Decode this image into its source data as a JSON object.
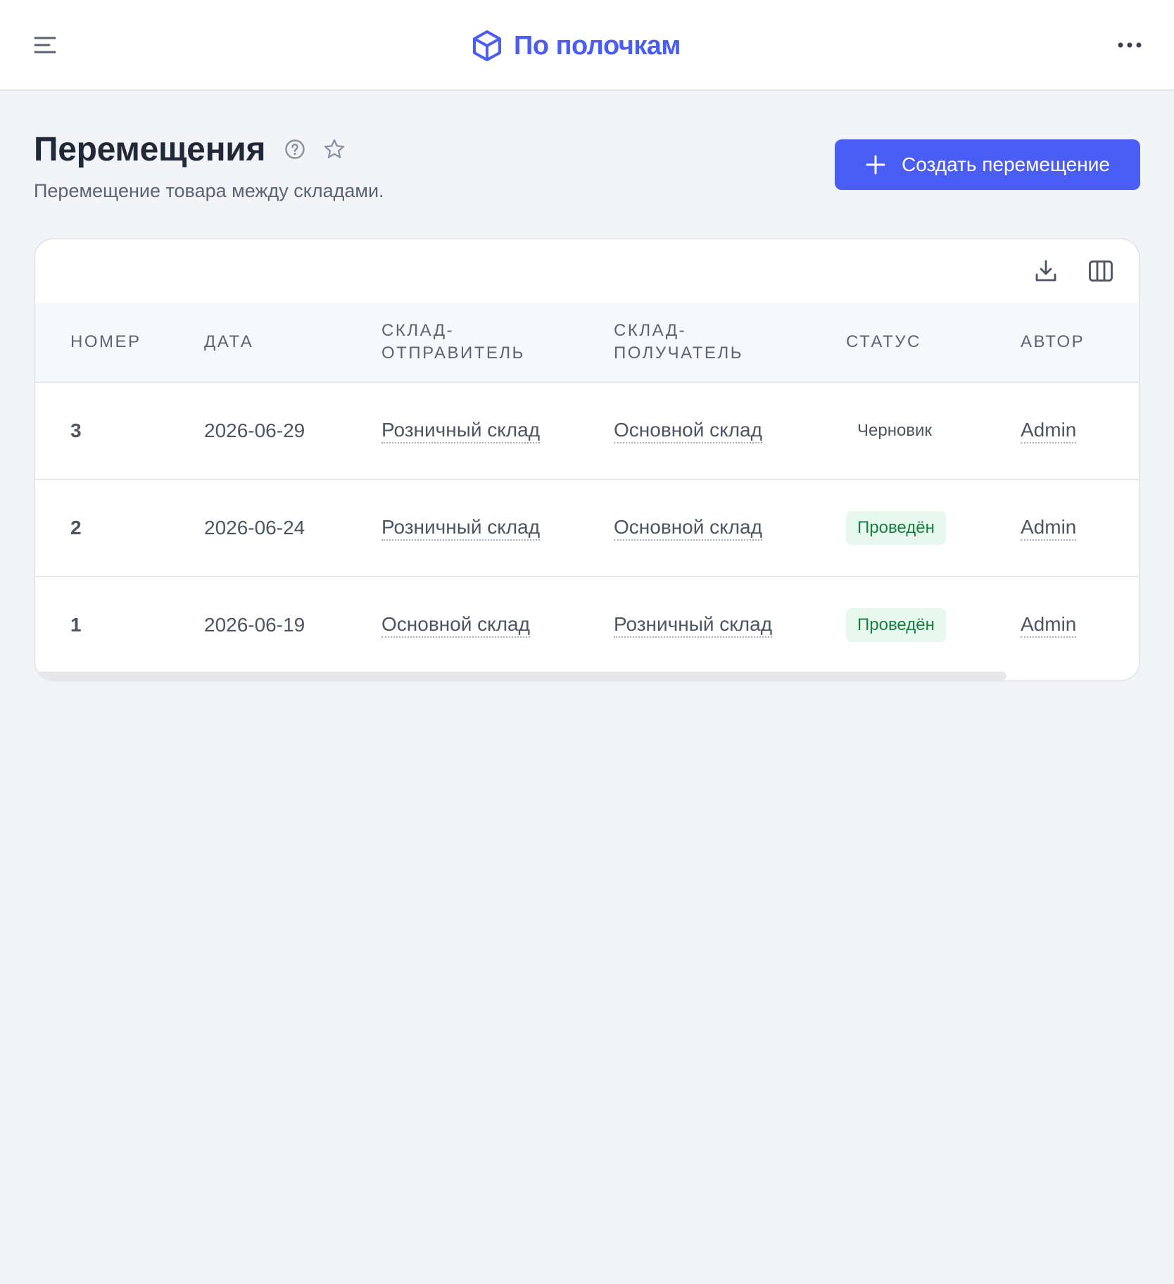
{
  "app": {
    "name": "По полочкам",
    "brand_color": "#4a5df5"
  },
  "header": {
    "menu_icon": "hamburger-menu-icon",
    "logo_icon": "cube-icon",
    "more_icon": "more-dots-icon"
  },
  "page": {
    "title": "Перемещения",
    "subtitle": "Перемещение товара между складами.",
    "help_icon": "help-circle-icon",
    "favorite_icon": "star-outline-icon",
    "create_button_label": "Создать перемещение",
    "create_button_icon": "plus-icon"
  },
  "table": {
    "toolbar": {
      "download_icon": "download-icon",
      "columns_icon": "columns-icon"
    },
    "columns": [
      "НОМЕР",
      "ДАТА",
      "СКЛАД-\nОТПРАВИТЕЛЬ",
      "СКЛАД-\nПОЛУЧАТЕЛЬ",
      "СТАТУС",
      "АВТОР"
    ],
    "rows": [
      {
        "number": "3",
        "date": "2026-06-29",
        "from": "Розничный склад",
        "to": "Основной склад",
        "status": "Черновик",
        "status_kind": "draft",
        "author": "Admin"
      },
      {
        "number": "2",
        "date": "2026-06-24",
        "from": "Розничный склад",
        "to": "Основной склад",
        "status": "Проведён",
        "status_kind": "done",
        "author": "Admin"
      },
      {
        "number": "1",
        "date": "2026-06-19",
        "from": "Основной склад",
        "to": "Розничный склад",
        "status": "Проведён",
        "status_kind": "done",
        "author": "Admin"
      }
    ],
    "status_colors": {
      "done_text": "#15803d",
      "done_bg": "#e8f8ee"
    }
  }
}
